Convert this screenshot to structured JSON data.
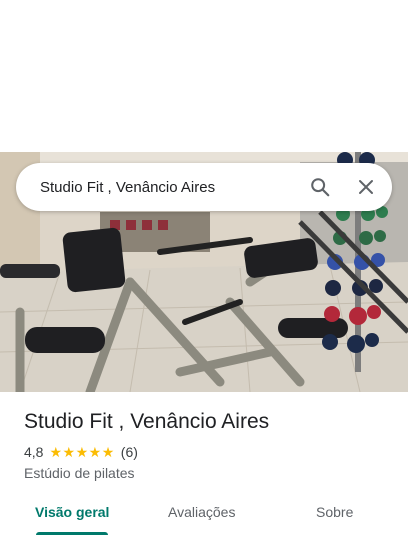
{
  "search": {
    "query": "Studio Fit , Venâncio Aires"
  },
  "place": {
    "title": "Studio Fit , Venâncio Aires",
    "rating": "4,8",
    "stars": 5,
    "review_count": "(6)",
    "category": "Estúdio de pilates"
  },
  "tabs": [
    {
      "label": "Visão geral",
      "active": true
    },
    {
      "label": "Avaliações",
      "active": false
    },
    {
      "label": "Sobre",
      "active": false
    }
  ],
  "colors": {
    "accent": "#00796b",
    "star": "#fbbc04"
  },
  "icons": {
    "search": "search-icon",
    "close": "close-icon"
  }
}
